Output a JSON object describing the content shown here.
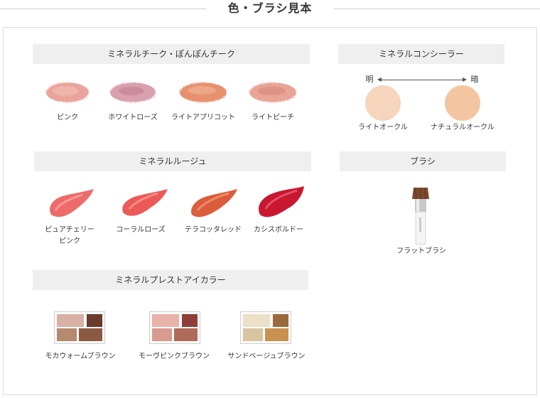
{
  "page_title": "色・ブラシ見本",
  "cheek": {
    "header": "ミネラルチーク・ぽんぽんチーク",
    "items": [
      {
        "label": "ピンク",
        "color": "#e9a39a"
      },
      {
        "label": "ホワイトローズ",
        "color": "#d9a0ae"
      },
      {
        "label": "ライトアプリコット",
        "color": "#e7906e"
      },
      {
        "label": "ライトピーチ",
        "color": "#e8a596"
      }
    ]
  },
  "concealer": {
    "header": "ミネラルコンシーラー",
    "light_label": "明",
    "dark_label": "暗",
    "items": [
      {
        "label": "ライトオークル",
        "color": "#f6d5bd"
      },
      {
        "label": "ナチュラルオークル",
        "color": "#f3c6a1"
      }
    ]
  },
  "rouge": {
    "header": "ミネラルルージュ",
    "items": [
      {
        "label_line1": "ピュアチェリー",
        "label_line2": "ピンク",
        "color": "#ee6b6b"
      },
      {
        "label_line1": "コーラルローズ",
        "label_line2": "",
        "color": "#ec5a57"
      },
      {
        "label_line1": "テラコッタレッド",
        "label_line2": "",
        "color": "#db5d3c"
      },
      {
        "label_line1": "カシスボルドー",
        "label_line2": "",
        "color": "#c8182f"
      }
    ]
  },
  "brush": {
    "header": "ブラシ",
    "label": "フラットブラシ"
  },
  "eyeshadow": {
    "header": "ミネラルプレストアイカラー",
    "items": [
      {
        "label": "モカウォームブラウン",
        "colors": [
          "#d9b0a6",
          "#6b3b2b",
          "#b58a6e",
          "#8c5a43"
        ]
      },
      {
        "label": "モーヴピンクブラウン",
        "colors": [
          "#e9b3aa",
          "#8f3f3a",
          "#d99a8f",
          "#b06a58"
        ]
      },
      {
        "label": "サンドベージュブラウン",
        "colors": [
          "#ece0c9",
          "#9a6a3c",
          "#d9c4a0",
          "#c8924e"
        ]
      }
    ]
  }
}
